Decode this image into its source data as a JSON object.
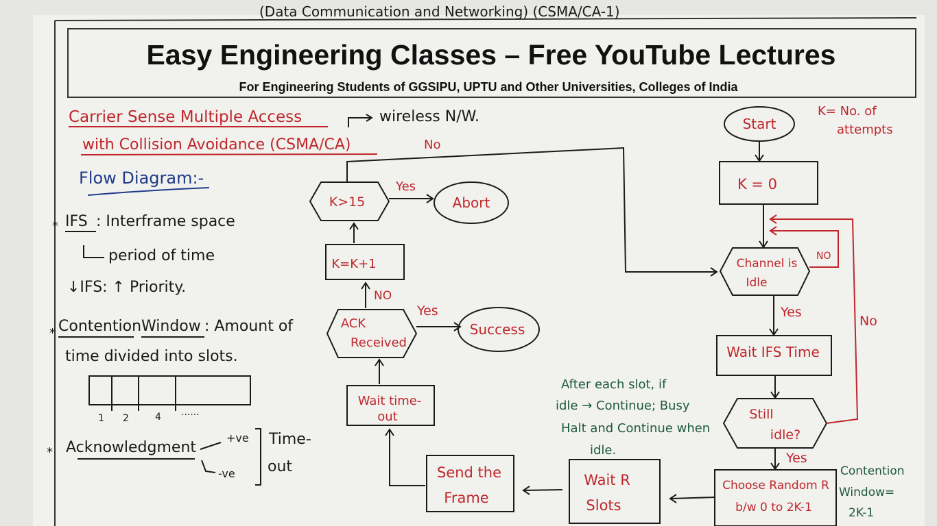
{
  "top_note": "(Data Communication and Networking) (CSMA/CA-1)",
  "banner": {
    "title": "Easy Engineering Classes – Free YouTube Lectures",
    "subtitle": "For Engineering Students of GGSIPU, UPTU and Other Universities, Colleges of India"
  },
  "heading": {
    "line1": "Carrier Sense Multiple Access",
    "arrow_note": "wireless N/W.",
    "line2": "with Collision Avoidance (CSMA/CA)"
  },
  "notes": {
    "flow_diagram": "Flow Diagram:-",
    "ifs_term": "IFS",
    "ifs_def": ": Interframe space",
    "ifs_period": "period of time",
    "ifs_priority": "↓IFS: ↑ Priority.",
    "cw_term1": "Contention",
    "cw_term2": "Window",
    "cw_def": ": Amount of",
    "cw_def2": "time divided into slots.",
    "slot_labels": [
      "1",
      "2",
      "4",
      "......"
    ],
    "ack_term": "Acknowledgment",
    "ack_pos": "+ve",
    "ack_neg": "-ve",
    "timeout1": "Time-",
    "timeout2": "out",
    "k_def1": "K= No. of",
    "k_def2": "attempts",
    "slot_rule1": "After each slot, if",
    "slot_rule2": "idle → Continue; Busy",
    "slot_rule3": "Halt and Continue when",
    "slot_rule4": "idle.",
    "cw_size1": "Contention",
    "cw_size2": "Window=",
    "cw_size3": "2K-1"
  },
  "flow": {
    "start": "Start",
    "k0": "K = 0",
    "channel_idle1": "Channel is",
    "channel_idle2": "Idle",
    "wait_ifs": "Wait IFS Time",
    "still_idle1": "Still",
    "still_idle2": "idle?",
    "choose_r1": "Choose Random R",
    "choose_r2": "b/w 0 to 2K-1",
    "wait_r1": "Wait R",
    "wait_r2": "Slots",
    "send_frame1": "Send the",
    "send_frame2": "Frame",
    "wait_timeout1": "Wait time-",
    "wait_timeout2": "out",
    "ack_received1": "ACK",
    "ack_received2": "Received",
    "success": "Success",
    "kinc": "K=K+1",
    "kgt15": "K>15",
    "abort": "Abort",
    "labels": {
      "yes": "Yes",
      "no": "No",
      "no_caps": "NO"
    }
  },
  "colors": {
    "red": "#c0262b",
    "black": "#1a1a1a",
    "green": "#1e5a3a",
    "blue": "#1f3a8a"
  }
}
